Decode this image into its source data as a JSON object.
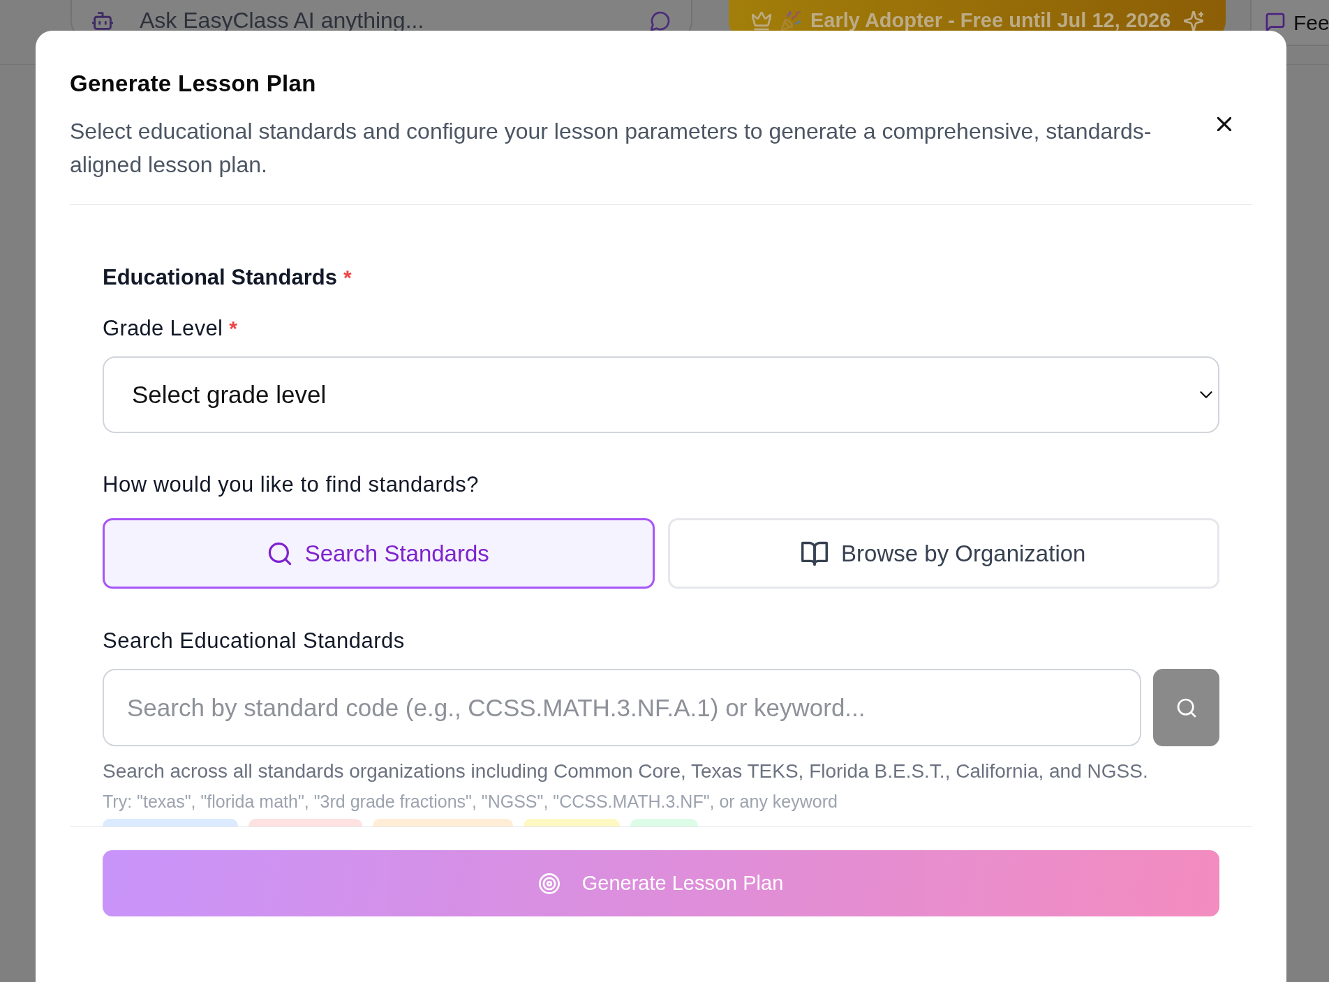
{
  "top_bar": {
    "ask_field": {
      "placeholder": "Ask EasyClass AI anything..."
    },
    "promo_badge": {
      "text": "Early Adopter - Free until Jul 12, 2026"
    },
    "feedback_button": {
      "label": "Fee"
    }
  },
  "dialog": {
    "title": "Generate Lesson Plan",
    "description": "Select educational standards and configure your lesson parameters to generate a comprehensive, standards-aligned lesson plan.",
    "section": {
      "title": "Educational Standards",
      "required_mark": "*"
    },
    "grade_level": {
      "label": "Grade Level",
      "required_mark": "*",
      "placeholder": "Select grade level"
    },
    "find_question": "How would you like to find standards?",
    "find_modes": [
      {
        "kind": "search",
        "label": "Search Standards",
        "selected": true
      },
      {
        "kind": "browse",
        "label": "Browse by Organization",
        "selected": false
      }
    ],
    "search": {
      "label": "Search Educational Standards",
      "placeholder": "Search by standard code (e.g., CCSS.MATH.3.NF.A.1) or keyword...",
      "button": {
        "disabled": true
      },
      "help": "Search across all standards organizations including Common Core, Texas TEKS, Florida B.E.S.T., California, and NGSS.",
      "examples": "Try: \"texas\", \"florida math\", \"3rd grade fractions\", \"NGSS\", \"CCSS.MATH.3.NF\", or any keyword"
    },
    "suggestion_chips": [
      {
        "color": "#dbeafe"
      },
      {
        "color": "#fee2e2"
      },
      {
        "color": "#ffedd5"
      },
      {
        "color": "#fef9c3"
      },
      {
        "color": "#dcfce7"
      }
    ],
    "generate_button": {
      "label": "Generate Lesson Plan",
      "disabled": true
    }
  }
}
